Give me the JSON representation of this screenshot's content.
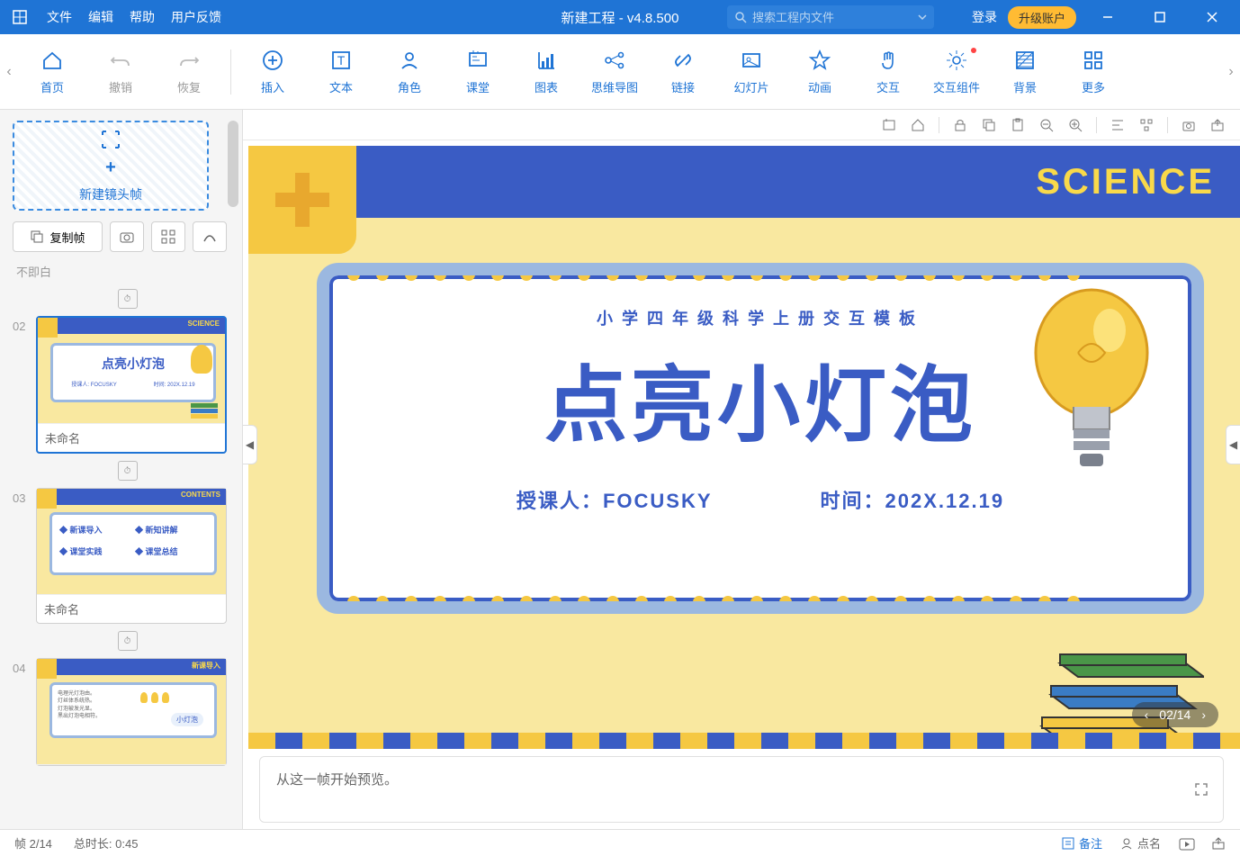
{
  "titlebar": {
    "menu": [
      "文件",
      "编辑",
      "帮助",
      "用户反馈"
    ],
    "title": "新建工程 - v4.8.500",
    "search_placeholder": "搜索工程内文件",
    "login": "登录",
    "upgrade": "升级账户"
  },
  "toolbar": {
    "items": [
      {
        "id": "home",
        "label": "首页",
        "icon": "home"
      },
      {
        "id": "undo",
        "label": "撤销",
        "icon": "undo",
        "dim": true
      },
      {
        "id": "redo",
        "label": "恢复",
        "icon": "redo",
        "dim": true
      },
      {
        "id": "divider"
      },
      {
        "id": "insert",
        "label": "插入",
        "icon": "plus-circle"
      },
      {
        "id": "text",
        "label": "文本",
        "icon": "text"
      },
      {
        "id": "role",
        "label": "角色",
        "icon": "person"
      },
      {
        "id": "class",
        "label": "课堂",
        "icon": "board"
      },
      {
        "id": "chart",
        "label": "图表",
        "icon": "chart"
      },
      {
        "id": "mindmap",
        "label": "思维导图",
        "icon": "mindmap"
      },
      {
        "id": "link",
        "label": "链接",
        "icon": "link"
      },
      {
        "id": "slides",
        "label": "幻灯片",
        "icon": "slides"
      },
      {
        "id": "anim",
        "label": "动画",
        "icon": "star"
      },
      {
        "id": "inter",
        "label": "交互",
        "icon": "hand"
      },
      {
        "id": "intercomp",
        "label": "交互组件",
        "icon": "spark",
        "dot": true
      },
      {
        "id": "bg",
        "label": "背景",
        "icon": "bg"
      },
      {
        "id": "more",
        "label": "更多",
        "icon": "grid"
      }
    ]
  },
  "sidebar": {
    "newframe": "新建镜头帧",
    "copyframe": "复制帧",
    "trunc": "不即白",
    "thumbs": [
      {
        "num": "02",
        "name": "未命名",
        "sel": true,
        "variant": "title"
      },
      {
        "num": "03",
        "name": "未命名",
        "sel": false,
        "variant": "contents"
      },
      {
        "num": "04",
        "name": "",
        "sel": false,
        "variant": "intro"
      }
    ]
  },
  "slide": {
    "science": "SCIENCE",
    "subtitle": "小学四年级科学上册交互模板",
    "title": "点亮小灯泡",
    "teacher_label": "授课人：",
    "teacher_value": "FOCUSKY",
    "time_label": "时间：",
    "time_value": "202X.12.19",
    "nav": "02/14"
  },
  "preview": {
    "text": "从这一帧开始预览。"
  },
  "statusbar": {
    "frame": "帧 2/14",
    "duration": "总时长: 0:45",
    "notes": "备注",
    "roll": "点名"
  },
  "thumb_contents": {
    "header": "CONTENTS",
    "items": [
      "新课导入",
      "新知讲解",
      "课堂实践",
      "课堂总结"
    ]
  },
  "thumb_intro": {
    "header": "新课导入"
  }
}
